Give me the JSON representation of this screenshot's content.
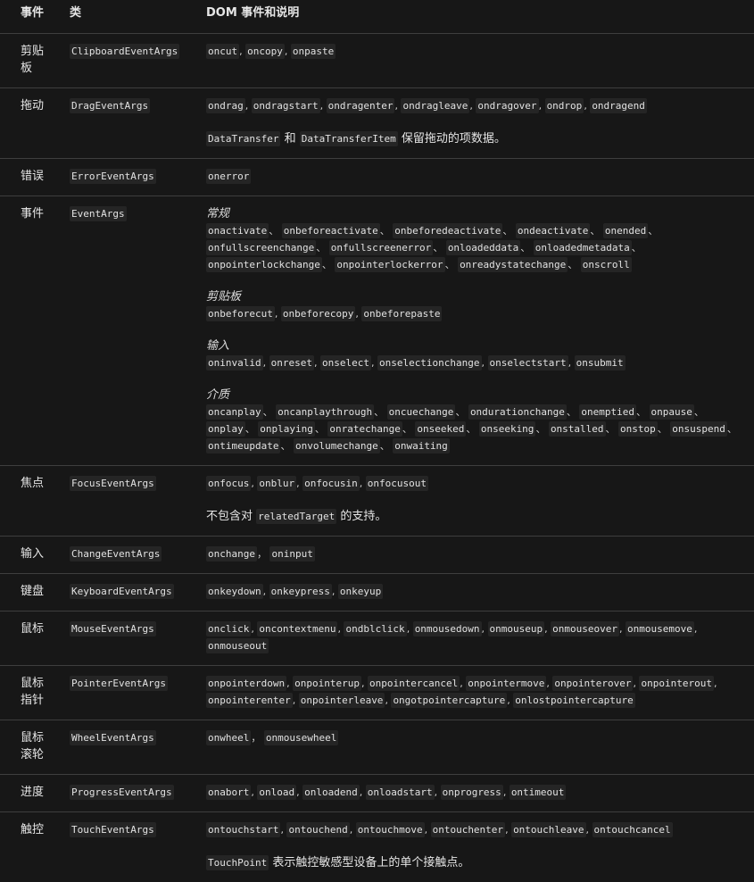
{
  "header": {
    "col_event": "事件",
    "col_class": "类",
    "col_dom": "DOM 事件和说明"
  },
  "rows": [
    {
      "event": "剪贴板",
      "class": "ClipboardEventArgs",
      "groups": [
        {
          "title": "",
          "sep": ", ",
          "events": [
            "oncut",
            "oncopy",
            "onpaste"
          ]
        }
      ]
    },
    {
      "event": "拖动",
      "class": "DragEventArgs",
      "groups": [
        {
          "title": "",
          "sep": ", ",
          "events": [
            "ondrag",
            "ondragstart",
            "ondragenter",
            "ondragleave",
            "ondragover",
            "ondrop",
            "ondragend"
          ]
        }
      ],
      "note": {
        "parts": [
          {
            "code": "DataTransfer"
          },
          {
            "text": " 和 "
          },
          {
            "code": "DataTransferItem"
          },
          {
            "text": " 保留拖动的项数据。"
          }
        ]
      }
    },
    {
      "event": "错误",
      "class": "ErrorEventArgs",
      "groups": [
        {
          "title": "",
          "sep": ", ",
          "events": [
            "onerror"
          ]
        }
      ]
    },
    {
      "event": "事件",
      "class": "EventArgs",
      "groups": [
        {
          "title": "常规",
          "sep": "、 ",
          "events": [
            "onactivate",
            "onbeforeactivate",
            "onbeforedeactivate",
            "ondeactivate",
            "onended",
            "onfullscreenchange",
            "onfullscreenerror",
            "onloadeddata",
            "onloadedmetadata",
            "onpointerlockchange",
            "onpointerlockerror",
            "onreadystatechange",
            "onscroll"
          ]
        },
        {
          "title": "剪贴板",
          "sep": ", ",
          "events": [
            "onbeforecut",
            "onbeforecopy",
            "onbeforepaste"
          ]
        },
        {
          "title": "输入",
          "sep": ", ",
          "events": [
            "oninvalid",
            "onreset",
            "onselect",
            "onselectionchange",
            "onselectstart",
            "onsubmit"
          ]
        },
        {
          "title": "介质",
          "sep": "、 ",
          "events": [
            "oncanplay",
            "oncanplaythrough",
            "oncuechange",
            "ondurationchange",
            "onemptied",
            "onpause",
            "onplay",
            "onplaying",
            "onratechange",
            "onseeked",
            "onseeking",
            "onstalled",
            "onstop",
            "onsuspend",
            "ontimeupdate",
            "onvolumechange",
            "onwaiting"
          ]
        }
      ]
    },
    {
      "event": "焦点",
      "class": "FocusEventArgs",
      "groups": [
        {
          "title": "",
          "sep": ", ",
          "events": [
            "onfocus",
            "onblur",
            "onfocusin",
            "onfocusout"
          ]
        }
      ],
      "note": {
        "parts": [
          {
            "text": "不包含对 "
          },
          {
            "code": "relatedTarget"
          },
          {
            "text": " 的支持。"
          }
        ]
      }
    },
    {
      "event": "输入",
      "class": "ChangeEventArgs",
      "groups": [
        {
          "title": "",
          "sep": "， ",
          "events": [
            "onchange",
            "oninput"
          ]
        }
      ]
    },
    {
      "event": "键盘",
      "class": "KeyboardEventArgs",
      "groups": [
        {
          "title": "",
          "sep": ", ",
          "events": [
            "onkeydown",
            "onkeypress",
            "onkeyup"
          ]
        }
      ]
    },
    {
      "event": "鼠标",
      "class": "MouseEventArgs",
      "groups": [
        {
          "title": "",
          "sep": ", ",
          "events": [
            "onclick",
            "oncontextmenu",
            "ondblclick",
            "onmousedown",
            "onmouseup",
            "onmouseover",
            "onmousemove",
            "onmouseout"
          ]
        }
      ]
    },
    {
      "event": "鼠标指针",
      "class": "PointerEventArgs",
      "groups": [
        {
          "title": "",
          "sep": ", ",
          "events": [
            "onpointerdown",
            "onpointerup",
            "onpointercancel",
            "onpointermove",
            "onpointerover",
            "onpointerout",
            "onpointerenter",
            "onpointerleave",
            "ongotpointercapture",
            "onlostpointercapture"
          ]
        }
      ]
    },
    {
      "event": "鼠标滚轮",
      "class": "WheelEventArgs",
      "groups": [
        {
          "title": "",
          "sep": "， ",
          "events": [
            "onwheel",
            "onmousewheel"
          ]
        }
      ]
    },
    {
      "event": "进度",
      "class": "ProgressEventArgs",
      "groups": [
        {
          "title": "",
          "sep": ", ",
          "events": [
            "onabort",
            "onload",
            "onloadend",
            "onloadstart",
            "onprogress",
            "ontimeout"
          ]
        }
      ]
    },
    {
      "event": "触控",
      "class": "TouchEventArgs",
      "groups": [
        {
          "title": "",
          "sep": ", ",
          "events": [
            "ontouchstart",
            "ontouchend",
            "ontouchmove",
            "ontouchenter",
            "ontouchleave",
            "ontouchcancel"
          ]
        }
      ],
      "note": {
        "parts": [
          {
            "code": "TouchPoint"
          },
          {
            "text": " 表示触控敏感型设备上的单个接触点。"
          }
        ]
      }
    }
  ]
}
